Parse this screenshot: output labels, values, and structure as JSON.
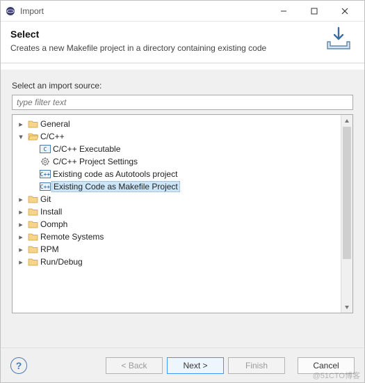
{
  "window": {
    "title": "Import"
  },
  "header": {
    "title": "Select",
    "desc": "Creates a new Makefile project in a directory containing existing code"
  },
  "body": {
    "select_label": "Select an import source:",
    "filter_placeholder": "type filter text"
  },
  "tree": {
    "general": "General",
    "ccpp": "C/C++",
    "ccpp_exec": "C/C++ Executable",
    "ccpp_proj_settings": "C/C++ Project Settings",
    "ccpp_autotools": "Existing code as Autotools project",
    "ccpp_makefile": "Existing Code as Makefile Project",
    "git": "Git",
    "install": "Install",
    "oomph": "Oomph",
    "remote_systems": "Remote Systems",
    "rpm": "RPM",
    "run_debug": "Run/Debug"
  },
  "buttons": {
    "back": "< Back",
    "next": "Next >",
    "finish": "Finish",
    "cancel": "Cancel"
  },
  "watermark": "@51CTO博客"
}
